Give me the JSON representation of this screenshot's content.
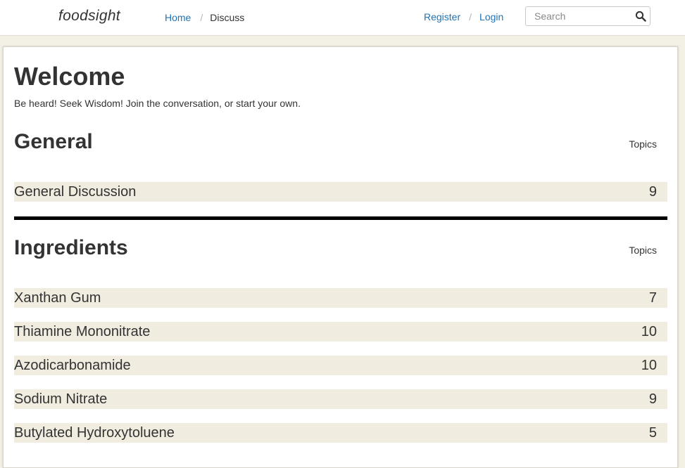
{
  "header": {
    "brand": "foodsight",
    "breadcrumb": {
      "home": "Home",
      "current": "Discuss"
    },
    "auth": {
      "register": "Register",
      "login": "Login"
    },
    "search": {
      "placeholder": "Search",
      "icon": "search-icon"
    }
  },
  "main": {
    "title": "Welcome",
    "subtitle": "Be heard! Seek Wisdom! Join the conversation, or start your own.",
    "sections": [
      {
        "title": "General",
        "column": "Topics",
        "rows": [
          {
            "name": "General Discussion",
            "count": "9"
          }
        ]
      },
      {
        "title": "Ingredients",
        "column": "Topics",
        "rows": [
          {
            "name": "Xanthan Gum",
            "count": "7"
          },
          {
            "name": "Thiamine Mononitrate",
            "count": "10"
          },
          {
            "name": "Azodicarbonamide",
            "count": "10"
          },
          {
            "name": "Sodium Nitrate",
            "count": "9"
          },
          {
            "name": "Butylated Hydroxytoluene",
            "count": "5"
          }
        ]
      }
    ]
  },
  "colors": {
    "link": "#1f73b7",
    "page_background": "#f3f0e6",
    "row_background": "#f1ece0",
    "divider": "#000000"
  }
}
